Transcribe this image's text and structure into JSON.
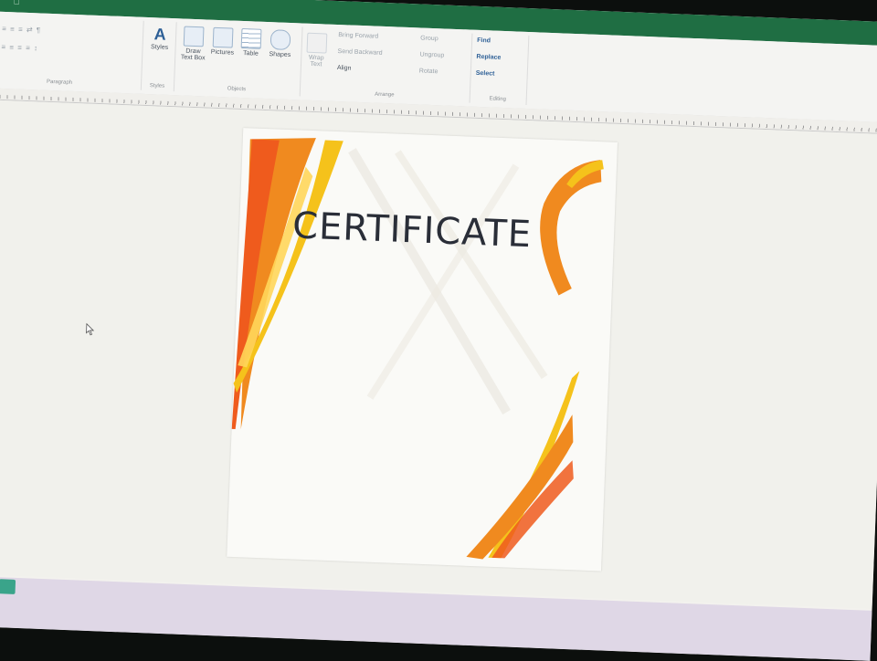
{
  "ribbon": {
    "groups": {
      "paragraph": "Paragraph",
      "styles": "Styles",
      "objects": "Objects",
      "arrange": "Arrange",
      "editing": "Editing"
    },
    "buttons": {
      "styles": "Styles",
      "draw_text_box": "Draw Text Box",
      "pictures": "Pictures",
      "table": "Table",
      "shapes": "Shapes",
      "wrap_text": "Wrap Text",
      "bring_forward": "Bring Forward",
      "send_backward": "Send Backward",
      "align": "Align",
      "group": "Group",
      "ungroup": "Ungroup",
      "rotate": "Rotate",
      "find": "Find",
      "replace": "Replace",
      "select": "Select"
    }
  },
  "document": {
    "title": "CERTIFICATE"
  },
  "colors": {
    "ribbon_green": "#1f6e43",
    "ribbon_orange": "#f08a1f",
    "ribbon_yellow": "#f5c21b"
  }
}
